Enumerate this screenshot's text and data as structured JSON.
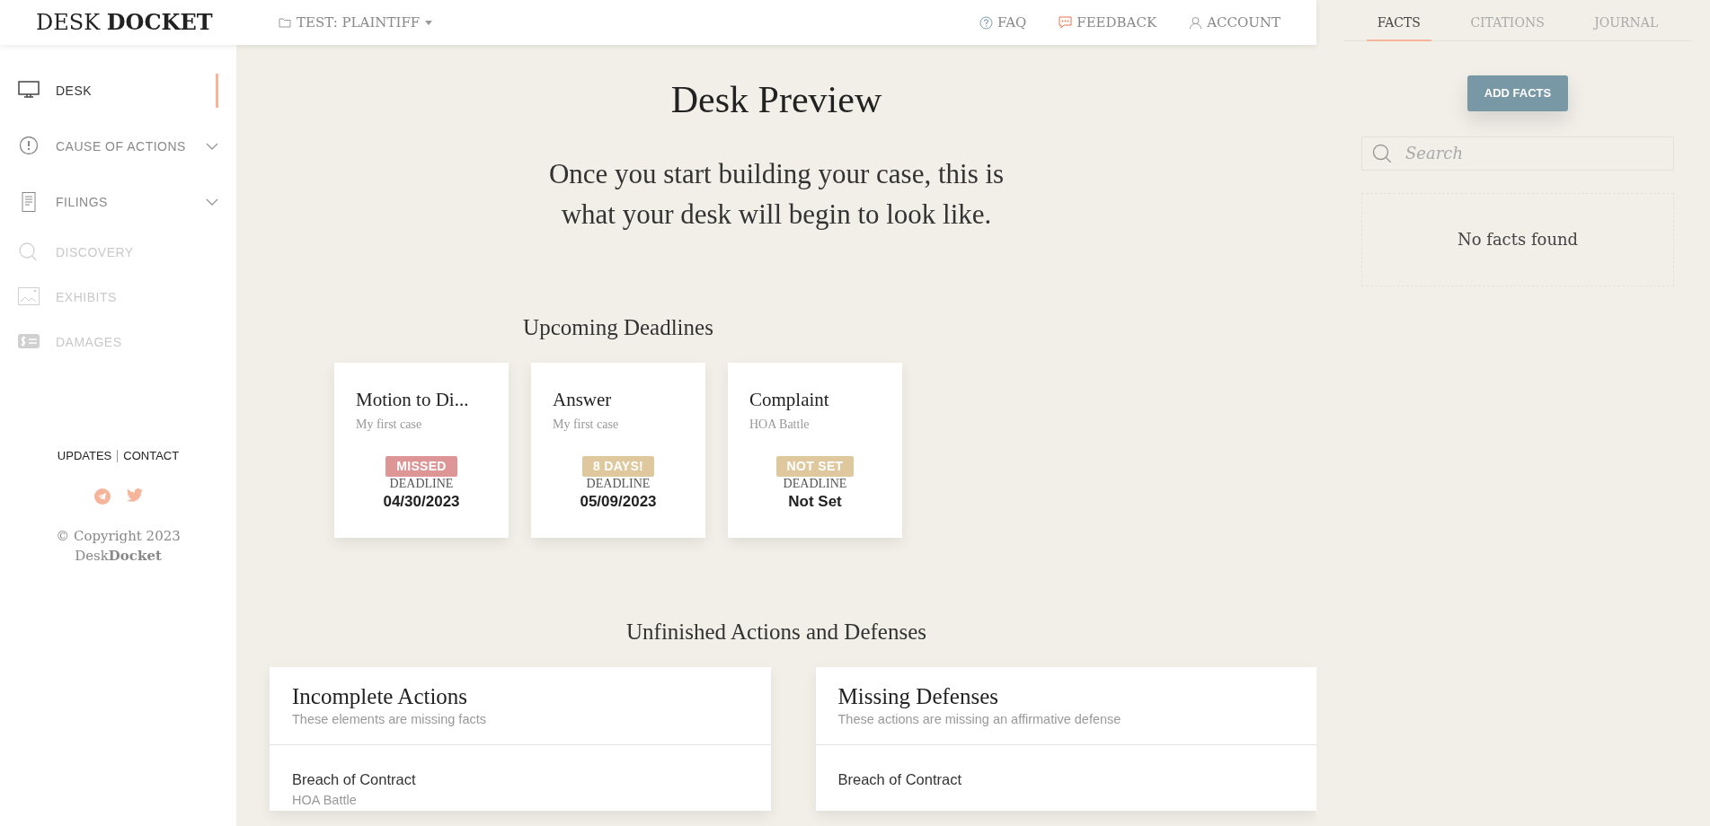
{
  "header": {
    "logo": "DESK **DOCKET**",
    "case_selector": "TEST: PLAINTIFF",
    "links": [
      {
        "label": "FAQ",
        "kind": "help"
      },
      {
        "label": "FEEDBACK",
        "kind": "feedback"
      },
      {
        "label": "ACCOUNT",
        "kind": "account"
      }
    ]
  },
  "sidebar": {
    "items": [
      {
        "label": "DESK",
        "kind": "monitor",
        "selected": true,
        "disabled": false,
        "expandable": false
      },
      {
        "label": "CAUSE OF ACTIONS",
        "kind": "alert",
        "selected": false,
        "disabled": false,
        "expandable": true
      },
      {
        "label": "FILINGS",
        "kind": "document",
        "selected": false,
        "disabled": false,
        "expandable": true
      },
      {
        "label": "DISCOVERY",
        "kind": "magnifier",
        "selected": false,
        "disabled": true,
        "expandable": false
      },
      {
        "label": "EXHIBITS",
        "kind": "image",
        "selected": false,
        "disabled": true,
        "expandable": false
      },
      {
        "label": "DAMAGES",
        "kind": "money",
        "selected": false,
        "disabled": true,
        "expandable": false
      }
    ],
    "footer_links": [
      "UPDATES",
      "CONTACT"
    ],
    "social": [
      {
        "kind": "telegram"
      },
      {
        "kind": "twitter"
      }
    ],
    "copyright": "© Copyright 2023",
    "brand": "Desk**Docket**"
  },
  "main": {
    "title": "Desk Preview",
    "subtitle": "Once you start building your case, this is what your desk will begin to look like.",
    "deadlines": {
      "title": "Upcoming Deadlines",
      "items": [
        {
          "title": "Motion to Di...",
          "case": "My first case",
          "status": "MISSED",
          "color": "#de9595",
          "label": "DEADLINE",
          "date": "04/30/2023"
        },
        {
          "title": "Answer",
          "case": "My first case",
          "status": "8 DAYS!",
          "color": "#e0c89e",
          "label": "DEADLINE",
          "date": "05/09/2023"
        },
        {
          "title": "Complaint",
          "case": "HOA Battle",
          "status": "NOT SET",
          "color": "#e0c89e",
          "label": "DEADLINE",
          "date": "Not Set"
        }
      ]
    },
    "unfinished": {
      "title": "Unfinished Actions and Defenses",
      "panels": [
        {
          "title": "Incomplete Actions",
          "subtitle": "These elements are missing facts",
          "items": [
            {
              "name": "Breach of Contract",
              "case": "HOA Battle"
            }
          ]
        },
        {
          "title": "Missing Defenses",
          "subtitle": "These actions are missing an affirmative defense",
          "items": [
            {
              "name": "Breach of Contract"
            }
          ]
        }
      ]
    }
  },
  "facts_panel": {
    "tabs": [
      {
        "label": "FACTS",
        "selected": true
      },
      {
        "label": "CITATIONS",
        "selected": false
      },
      {
        "label": "JOURNAL",
        "selected": false
      }
    ],
    "add_button": "ADD FACTS",
    "search": {
      "placeholder": "Search"
    },
    "empty_message": "No facts found"
  }
}
